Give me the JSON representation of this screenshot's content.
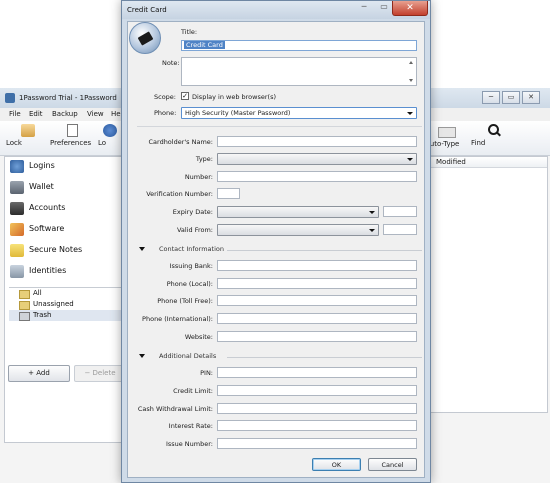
{
  "main_window": {
    "title": "1Password Trial - 1Password",
    "menu": [
      "File",
      "Edit",
      "Backup",
      "View",
      "He"
    ],
    "toolbar": {
      "lock": "Lock",
      "preferences": "Preferences",
      "lo": "Lo",
      "auto_type": "Auto-Type",
      "find": "Find"
    },
    "categories": [
      "Logins",
      "Wallet",
      "Accounts",
      "Software",
      "Secure Notes",
      "Identities"
    ],
    "folders": [
      "All",
      "Unassigned",
      "Trash"
    ],
    "add_label": "+ Add",
    "delete_label": "− Delete",
    "column_header": "Modified",
    "window_controls": [
      "─",
      "▭",
      "✕"
    ]
  },
  "dialog": {
    "title": "Credit Card",
    "close": "✕",
    "controls": [
      "─",
      "▭"
    ],
    "title_label": "Title:",
    "title_value": "Credit Card",
    "note_label": "Note:",
    "scope_label": "Scope:",
    "scope_checkbox_label": "Display in web browser(s)",
    "phone_label": "Phone:",
    "phone_value": "High Security (Master Password)",
    "fields": {
      "cardholder": "Cardholder's Name:",
      "type": "Type:",
      "number": "Number:",
      "verification": "Verification Number:",
      "expiry": "Expiry Date:",
      "valid_from": "Valid From:"
    },
    "contact_section": "Contact Information",
    "contact_fields": {
      "issuing_bank": "Issuing Bank:",
      "phone_local": "Phone (Local):",
      "phone_tollfree": "Phone (Toll Free):",
      "phone_intl": "Phone (International):",
      "website": "Website:"
    },
    "additional_section": "Additional Details",
    "additional_fields": {
      "pin": "PIN:",
      "credit_limit": "Credit Limit:",
      "cash_limit": "Cash Withdrawal Limit:",
      "interest_rate": "Interest Rate:",
      "issue_number": "Issue Number:"
    },
    "ok": "OK",
    "cancel": "Cancel"
  }
}
